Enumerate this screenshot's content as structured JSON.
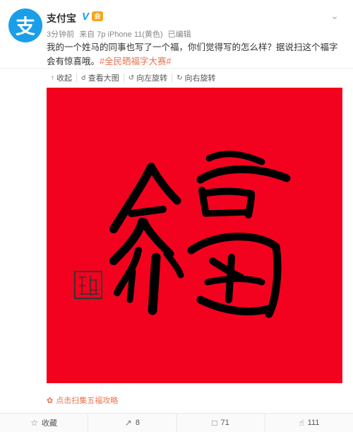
{
  "post": {
    "avatar_char": "支",
    "username": "支付宝",
    "verified_badge": "V",
    "member_badge": "会",
    "time": "3分钟前",
    "source": "来自 7p iPhone 11(黄色)",
    "edited": "已编辑",
    "text": "我的一个姓马的同事也写了一个福，你们觉得写的怎么样？据说扫这个福字会有惊喜哦。",
    "hashtag": "#全民晒福字大赛#",
    "image_alt_color": "#f2021e"
  },
  "toolbar": {
    "collapse": "收起",
    "view_large": "查看大图",
    "rotate_left": "向左旋转",
    "rotate_right": "向右旋转"
  },
  "promo_link": "点击扫集五福攻略",
  "actions": {
    "favorite": "收藏",
    "repost_count": "8",
    "comment_count": "71",
    "like_count": "111"
  },
  "colors": {
    "brand_blue": "#1a9ee8",
    "accent_orange": "#eb7350",
    "poster_red": "#f2021e"
  }
}
